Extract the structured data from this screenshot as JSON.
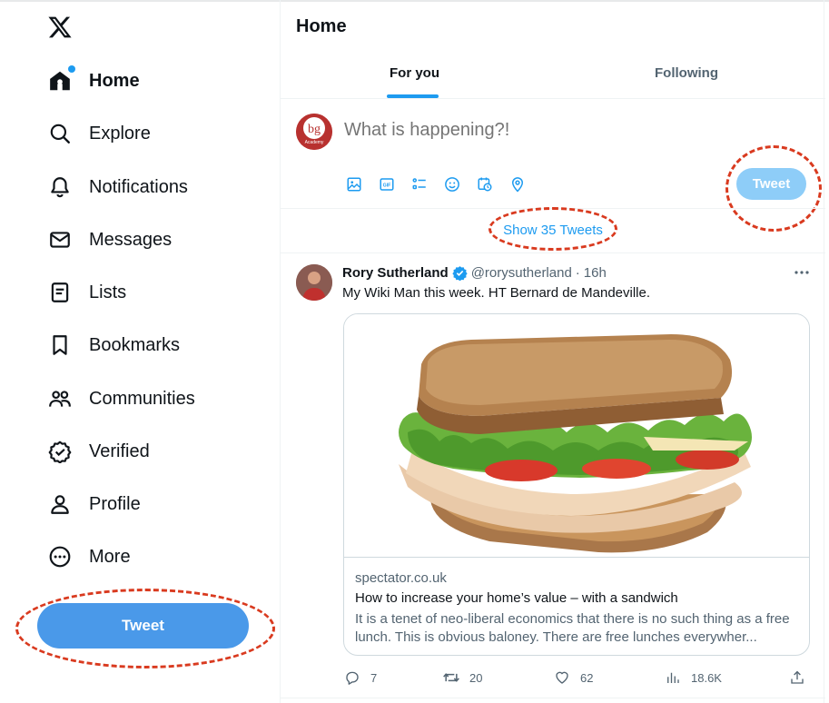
{
  "sidebar": {
    "items": [
      {
        "label": "Home",
        "icon": "home-icon"
      },
      {
        "label": "Explore",
        "icon": "search-icon"
      },
      {
        "label": "Notifications",
        "icon": "bell-icon"
      },
      {
        "label": "Messages",
        "icon": "envelope-icon"
      },
      {
        "label": "Lists",
        "icon": "list-icon"
      },
      {
        "label": "Bookmarks",
        "icon": "bookmark-icon"
      },
      {
        "label": "Communities",
        "icon": "people-icon"
      },
      {
        "label": "Verified",
        "icon": "verified-badge-icon"
      },
      {
        "label": "Profile",
        "icon": "person-icon"
      },
      {
        "label": "More",
        "icon": "more-circle-icon"
      }
    ],
    "tweet_button": "Tweet"
  },
  "main": {
    "title": "Home",
    "tabs": [
      {
        "label": "For you",
        "active": true
      },
      {
        "label": "Following",
        "active": false
      }
    ],
    "compose": {
      "placeholder": "What is happening?!",
      "avatar_text": "bg",
      "avatar_subtext": "Academy",
      "tweet_button": "Tweet",
      "icons": [
        "image-icon",
        "gif-icon",
        "poll-icon",
        "emoji-icon",
        "schedule-icon",
        "location-icon"
      ]
    },
    "show_tweets": "Show 35 Tweets",
    "post": {
      "name": "Rory Sutherland",
      "handle": "@rorysutherland",
      "separator": "·",
      "time": "16h",
      "text": "My Wiki Man this week. HT Bernard de Mandeville.",
      "card": {
        "domain": "spectator.co.uk",
        "title": "How to increase your home’s value – with a sandwich",
        "description": "It is a tenet of neo-liberal economics that there is no such thing as a free lunch. This is obvious baloney. There are free lunches everywher..."
      },
      "actions": {
        "replies": "7",
        "retweets": "20",
        "likes": "62",
        "views": "18.6K"
      }
    }
  },
  "colors": {
    "accent": "#1d9bf0",
    "tweet_button": "#4a99e9",
    "tweet_button_disabled": "#8ecdf8",
    "annotation": "#d93a1f"
  }
}
